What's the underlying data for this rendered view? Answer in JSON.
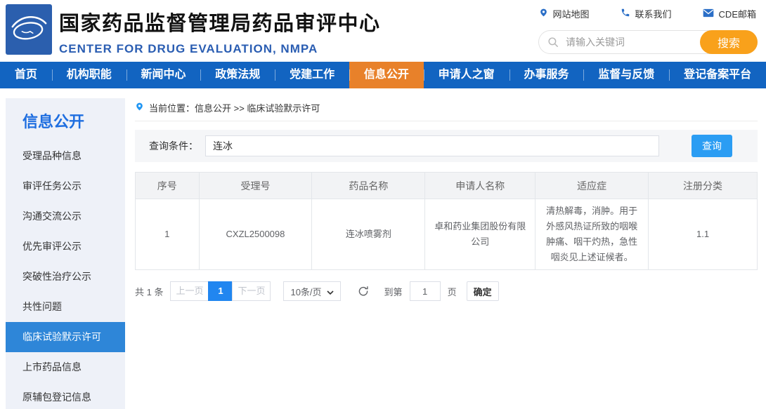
{
  "header": {
    "site_title": "国家药品监督管理局药品审评中心",
    "site_subtitle": "CENTER FOR DRUG EVALUATION, NMPA",
    "quick_links": [
      {
        "icon": "location-pin-icon",
        "label": "网站地图"
      },
      {
        "icon": "phone-icon",
        "label": "联系我们"
      },
      {
        "icon": "envelope-icon",
        "label": "CDE邮箱"
      }
    ],
    "search": {
      "placeholder": "请输入关键词",
      "button_label": "搜索"
    }
  },
  "nav": {
    "items": [
      {
        "label": "首页",
        "active": false
      },
      {
        "label": "机构职能",
        "active": false
      },
      {
        "label": "新闻中心",
        "active": false
      },
      {
        "label": "政策法规",
        "active": false
      },
      {
        "label": "党建工作",
        "active": false
      },
      {
        "label": "信息公开",
        "active": true
      },
      {
        "label": "申请人之窗",
        "active": false
      },
      {
        "label": "办事服务",
        "active": false
      },
      {
        "label": "监督与反馈",
        "active": false
      },
      {
        "label": "登记备案平台",
        "active": false
      }
    ]
  },
  "sidebar": {
    "title": "信息公开",
    "items": [
      {
        "label": "受理品种信息",
        "active": false
      },
      {
        "label": "审评任务公示",
        "active": false
      },
      {
        "label": "沟通交流公示",
        "active": false
      },
      {
        "label": "优先审评公示",
        "active": false
      },
      {
        "label": "突破性治疗公示",
        "active": false
      },
      {
        "label": "共性问题",
        "active": false
      },
      {
        "label": "临床试验默示许可",
        "active": true
      },
      {
        "label": "上市药品信息",
        "active": false
      },
      {
        "label": "原辅包登记信息",
        "active": false
      }
    ]
  },
  "breadcrumb": {
    "text": "当前位置：信息公开 >> 临床试验默示许可"
  },
  "query": {
    "label": "查询条件：",
    "value": "连冰",
    "button_label": "查询"
  },
  "table": {
    "columns": [
      "序号",
      "受理号",
      "药品名称",
      "申请人名称",
      "适应症",
      "注册分类"
    ],
    "rows": [
      [
        "1",
        "CXZL2500098",
        "连冰喷雾剂",
        "卓和药业集团股份有限公司",
        "清热解毒，消肿。用于外感风热证所致的咽喉肿痛、咽干灼热，急性咽炎见上述证候者。",
        "1.1"
      ]
    ]
  },
  "pagination": {
    "total_text": "共 1 条",
    "prev_label": "上一页",
    "page": "1",
    "next_label": "下一页",
    "page_size_label": "10条/页",
    "goto_prefix": "到第",
    "goto_value": "1",
    "goto_suffix": "页",
    "confirm_label": "确定"
  },
  "colors": {
    "nav_blue": "#1264c1",
    "nav_active_orange": "#e8812a",
    "logo_blue": "#2b5fae",
    "subtitle_blue": "#2a5db2",
    "search_button_orange": "#f9a11b",
    "sidebar_bg": "#eef1f8",
    "sidebar_title_blue": "#1e6ee0",
    "sidebar_active_blue": "#2e86d8",
    "query_button_blue": "#2b9df3",
    "page_active_blue": "#2186f0",
    "table_header_bg": "#f2f3f5",
    "border_gray": "#dcdfe6"
  }
}
